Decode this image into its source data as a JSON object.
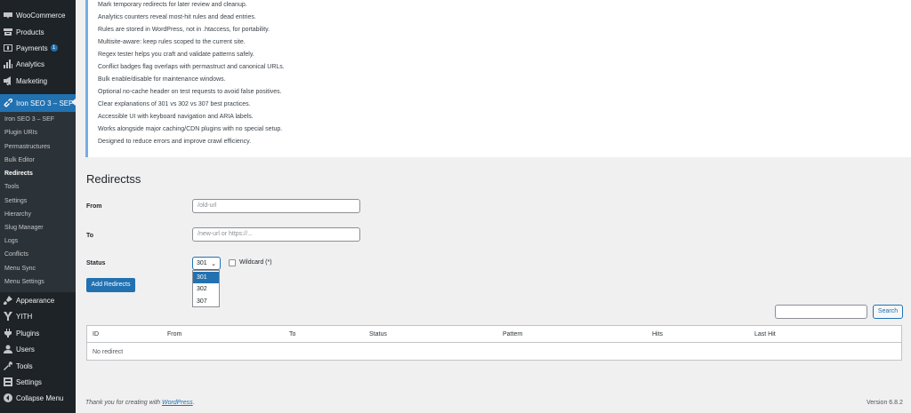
{
  "sidebar": {
    "items": [
      {
        "label": "WooCommerce",
        "icon": "woocommerce-icon"
      },
      {
        "label": "Products",
        "icon": "archive-icon"
      },
      {
        "label": "Payments",
        "icon": "payments-icon",
        "badge": "1"
      },
      {
        "label": "Analytics",
        "icon": "chart-bar-icon"
      },
      {
        "label": "Marketing",
        "icon": "megaphone-icon"
      },
      {
        "label": "Iron SEO 3 – SEF",
        "icon": "link-icon"
      },
      {
        "label": "Appearance",
        "icon": "brush-icon"
      },
      {
        "label": "YITH",
        "icon": "yith-icon"
      },
      {
        "label": "Plugins",
        "icon": "plugin-icon"
      },
      {
        "label": "Users",
        "icon": "user-icon"
      },
      {
        "label": "Tools",
        "icon": "wrench-icon"
      },
      {
        "label": "Settings",
        "icon": "settings-icon"
      },
      {
        "label": "Collapse Menu",
        "icon": "collapse-icon"
      }
    ],
    "submenu": [
      "Iron SEO 3 – SEF",
      "Plugin URIs",
      "Permastructures",
      "Bulk Editor",
      "Redirects",
      "Tools",
      "Settings",
      "Hierarchy",
      "Slug Manager",
      "Logs",
      "Conflicts",
      "Menu Sync",
      "Menu Settings"
    ]
  },
  "notice": {
    "lines": [
      "Mark temporary redirects for later review and cleanup.",
      "Analytics counters reveal most-hit rules and dead entries.",
      "Rules are stored in WordPress, not in .htaccess, for portability.",
      "Multisite-aware: keep rules scoped to the current site.",
      "Regex tester helps you craft and validate patterns safely.",
      "Conflict badges flag overlaps with permastruct and canonical URLs.",
      "Bulk enable/disable for maintenance windows.",
      "Optional no-cache header on test requests to avoid false positives.",
      "Clear explanations of 301 vs 302 vs 307 best practices.",
      "Accessible UI with keyboard navigation and ARIA labels.",
      "Works alongside major caching/CDN plugins with no special setup.",
      "Designed to reduce errors and improve crawl efficiency."
    ]
  },
  "page": {
    "title": "Redirectss"
  },
  "form": {
    "from_label": "From",
    "from_placeholder": "/old-url",
    "to_label": "To",
    "to_placeholder": "/new-url or https://...",
    "status_label": "Status",
    "status_value": "301",
    "status_options": [
      "301",
      "302",
      "307"
    ],
    "wildcard_label": "Wildcard (*)",
    "add_button": "Add Redirects"
  },
  "search": {
    "button": "Search",
    "value": ""
  },
  "table": {
    "columns": [
      "ID",
      "From",
      "To",
      "Status",
      "Pattern",
      "Hits",
      "Last Hit"
    ],
    "empty": "No redirect"
  },
  "footer": {
    "thanks_prefix": "Thank you for creating with ",
    "thanks_link": "WordPress",
    "thanks_suffix": ".",
    "version": "Version 6.8.2"
  },
  "colors": {
    "accent": "#2271b1",
    "sidebar": "#1d2327",
    "notice_border": "#72aee6"
  }
}
